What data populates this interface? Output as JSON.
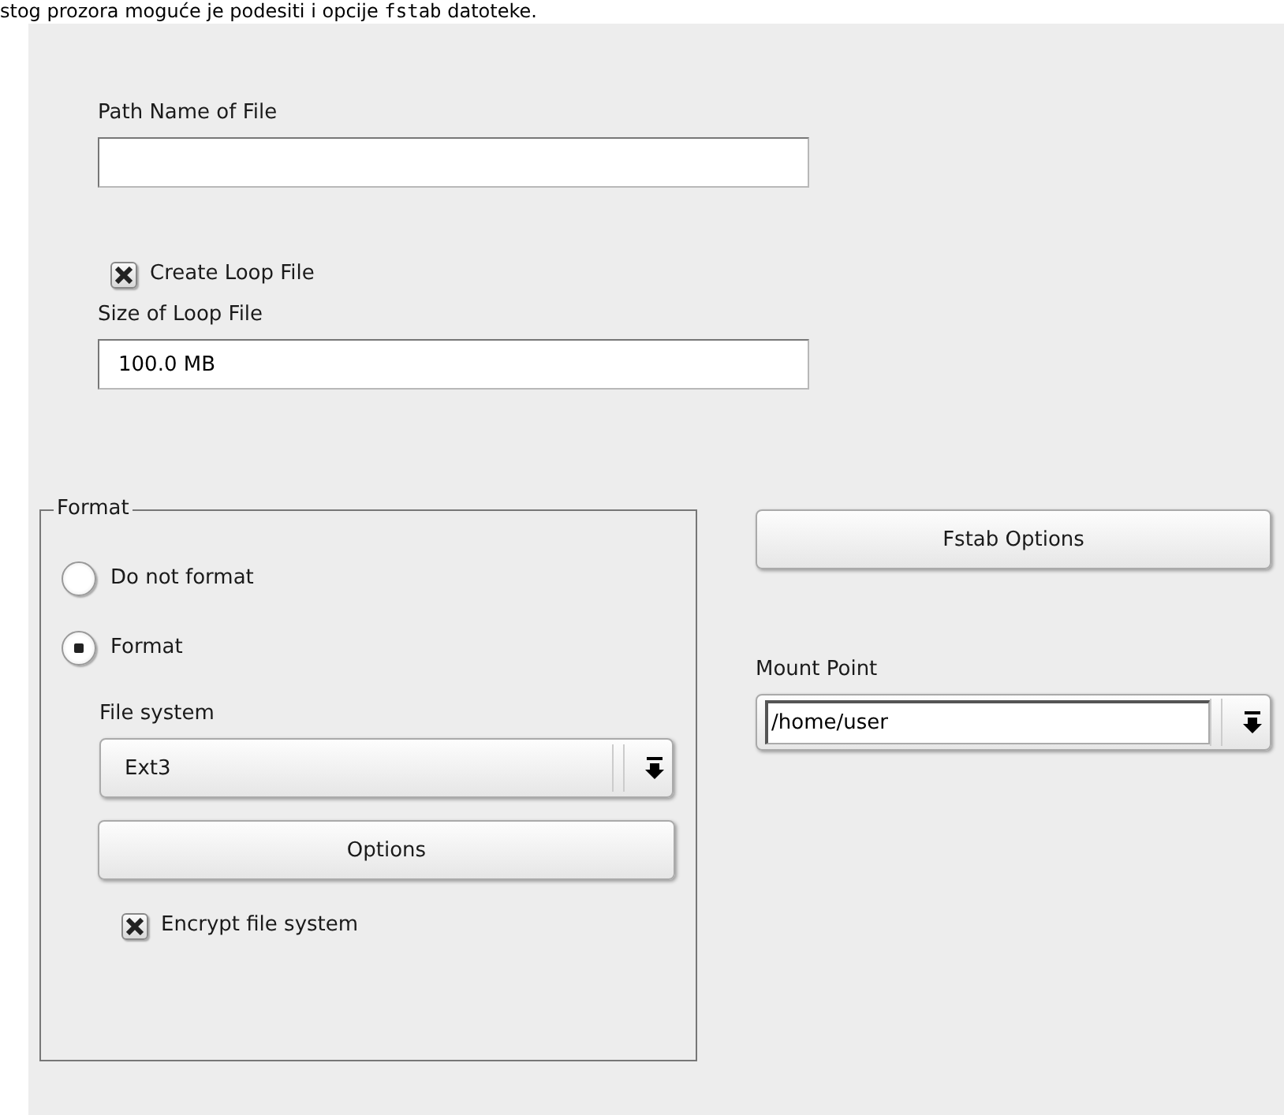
{
  "intro": {
    "text_before": "stog prozora moguće je podesiti i opcije ",
    "code": "fstab",
    "text_after": " datoteke."
  },
  "path_field": {
    "label": "Path Name of File"
  },
  "create_loop": {
    "label": "Create Loop File",
    "checked": true
  },
  "size_field": {
    "label": "Size of Loop File",
    "value": "100.0 MB"
  },
  "format_group": {
    "title": "Format",
    "options": [
      {
        "label": "Do not format",
        "selected": false
      },
      {
        "label": "Format",
        "selected": true
      }
    ],
    "file_system": {
      "label": "File system",
      "value": "Ext3"
    },
    "options_button": {
      "label": "Options"
    },
    "encrypt": {
      "label": "Encrypt file system",
      "checked": true
    }
  },
  "fstab_button": {
    "label": "Fstab Options"
  },
  "mount_point": {
    "label": "Mount Point",
    "value": "/home/user"
  }
}
